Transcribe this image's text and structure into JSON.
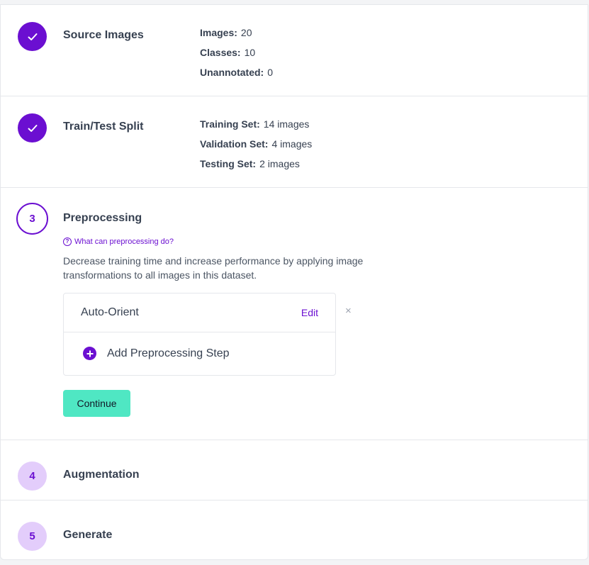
{
  "steps": [
    {
      "title": "Source Images",
      "status": "done",
      "icon": "checkmark-icon",
      "stats": [
        {
          "label": "Images:",
          "value": "20"
        },
        {
          "label": "Classes:",
          "value": "10"
        },
        {
          "label": "Unannotated:",
          "value": "0"
        }
      ]
    },
    {
      "title": "Train/Test Split",
      "status": "done",
      "icon": "checkmark-icon",
      "stats": [
        {
          "label": "Training Set:",
          "value": "14 images"
        },
        {
          "label": "Validation Set:",
          "value": "4 images"
        },
        {
          "label": "Testing Set:",
          "value": "2 images"
        }
      ]
    },
    {
      "number": "3",
      "title": "Preprocessing",
      "status": "active",
      "help_link": "What can preprocessing do?",
      "description": "Decrease training time and increase performance by applying image transformations to all images in this dataset.",
      "applied_steps": [
        {
          "name": "Auto-Orient",
          "edit_label": "Edit"
        }
      ],
      "add_step_label": "Add Preprocessing Step",
      "remove_glyph": "×",
      "continue_label": "Continue"
    },
    {
      "number": "4",
      "title": "Augmentation",
      "status": "pending"
    },
    {
      "number": "5",
      "title": "Generate",
      "status": "pending"
    }
  ],
  "colors": {
    "accent": "#6b0fd1",
    "pending_circle": "#e3cdfb",
    "continue_button": "#4fe7c3"
  }
}
